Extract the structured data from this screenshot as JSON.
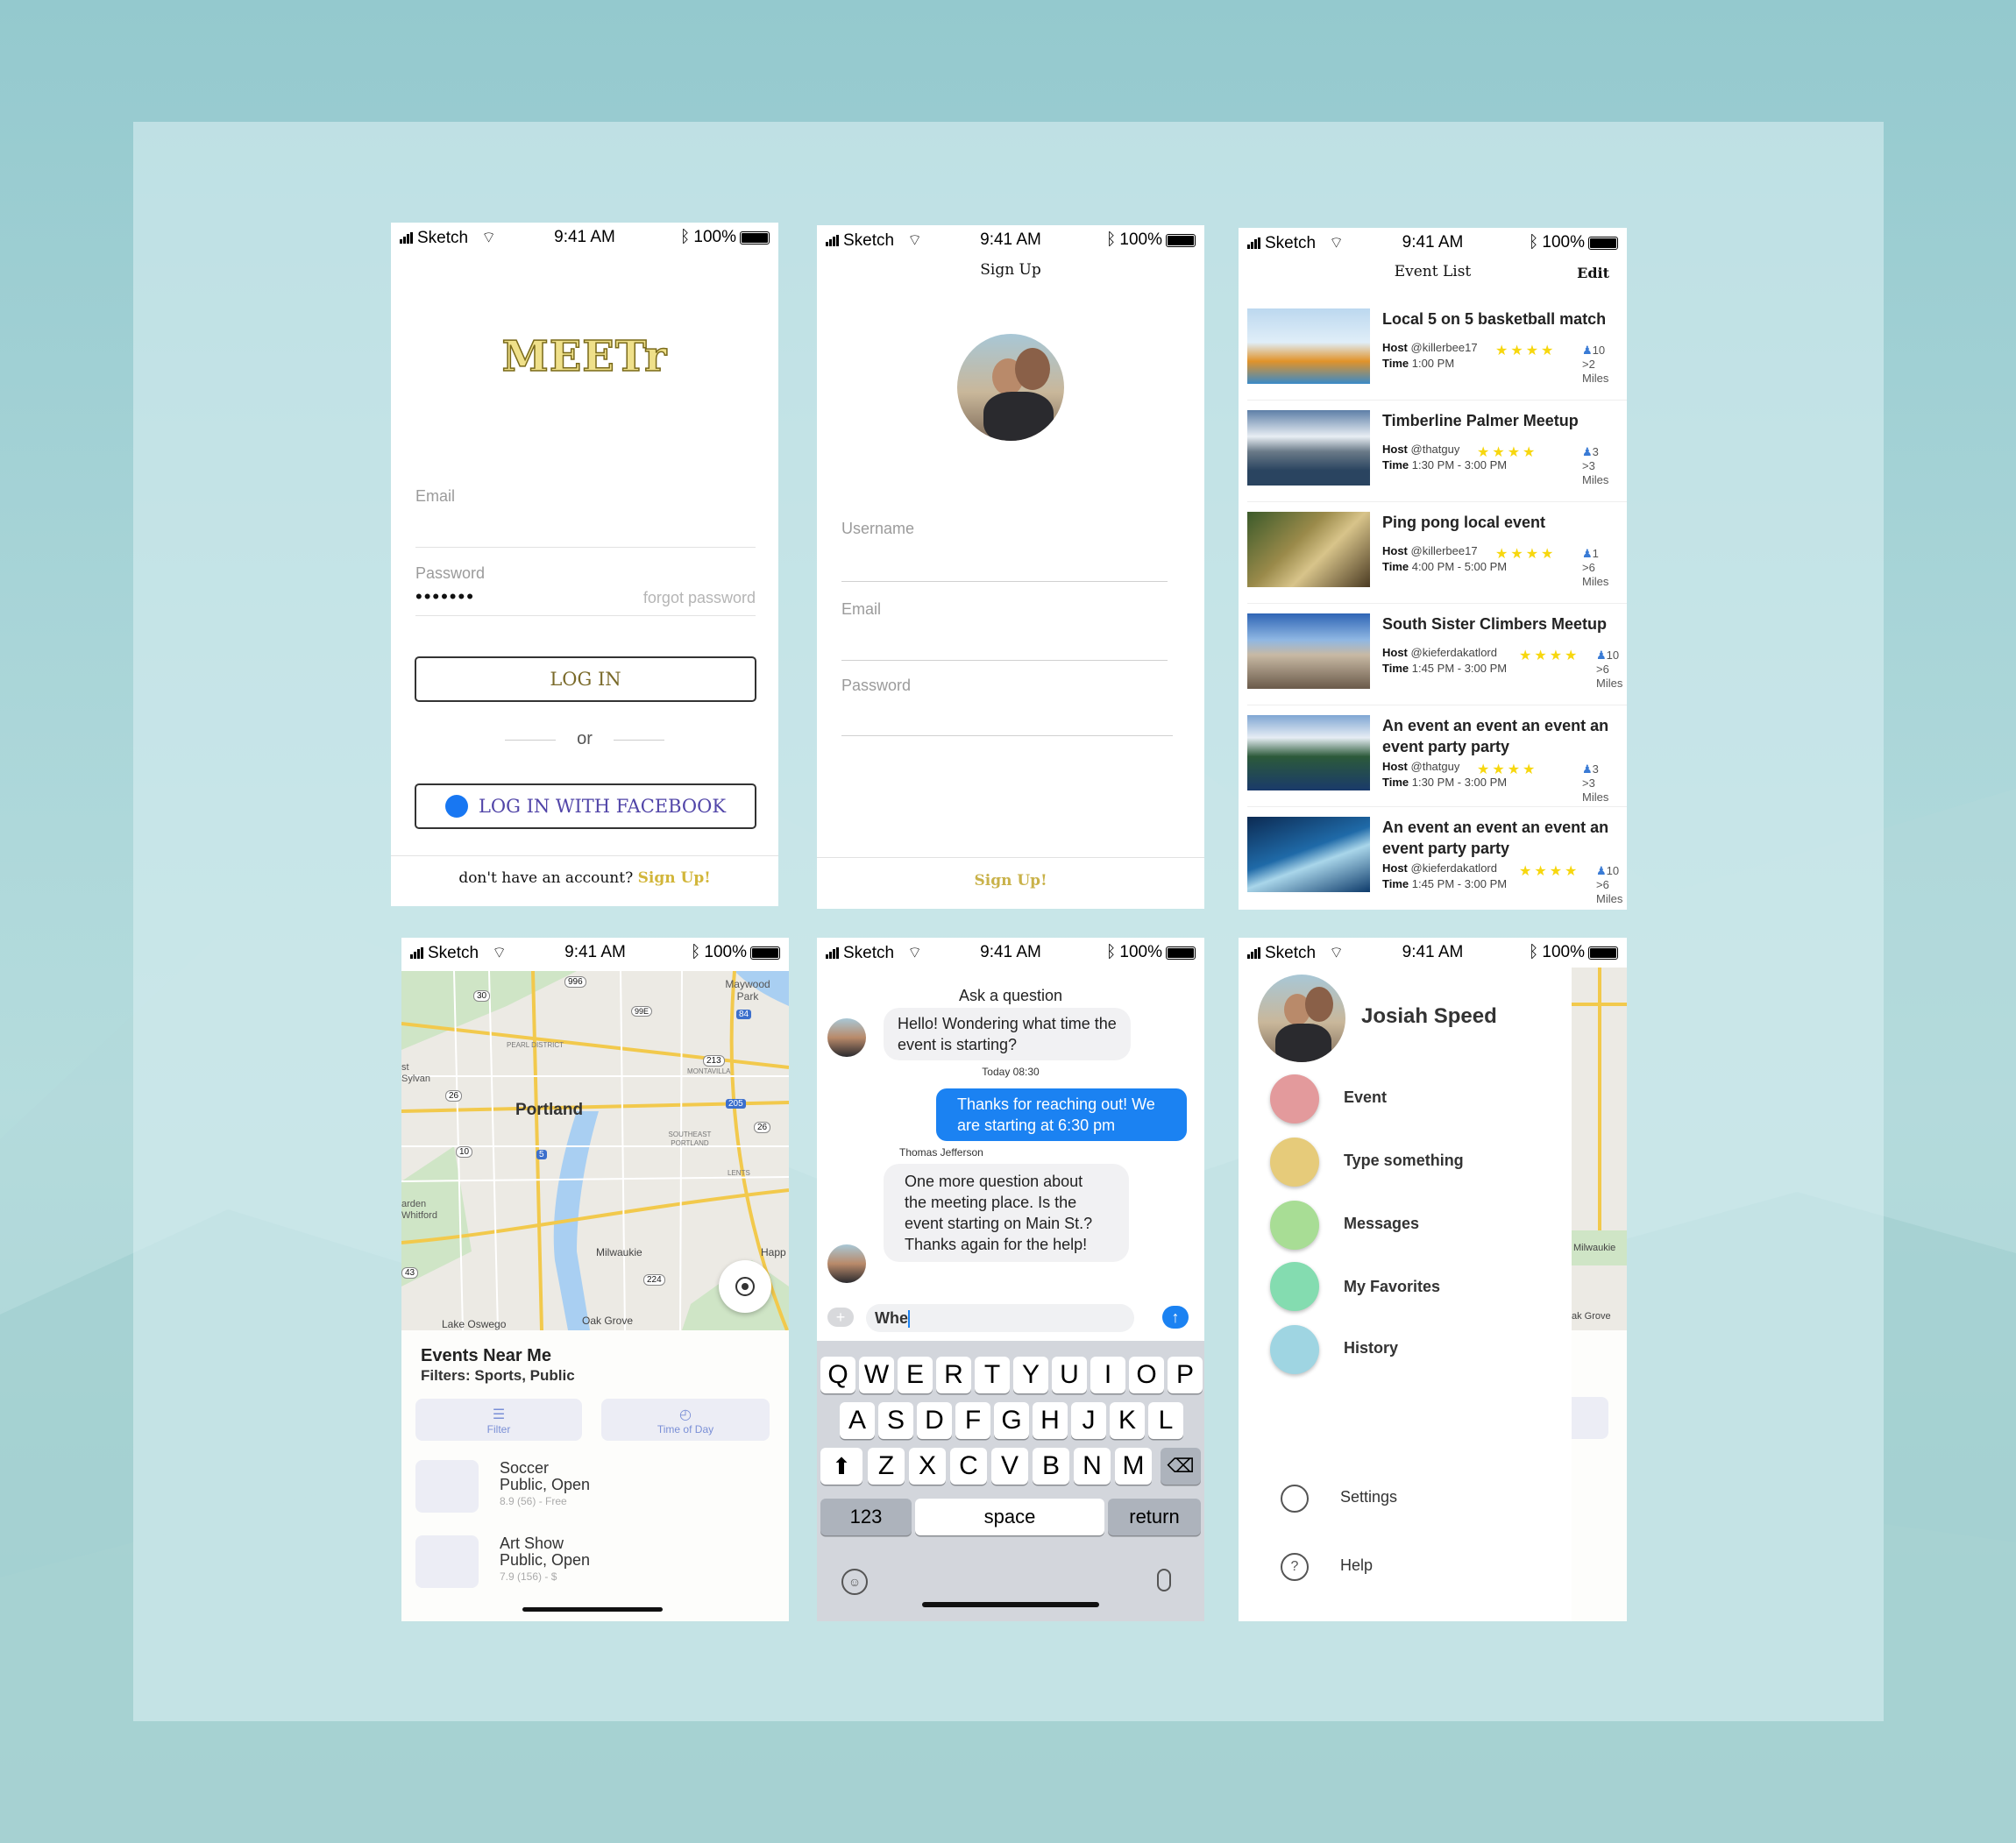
{
  "status": {
    "carrier": "Sketch",
    "time": "9:41 AM",
    "battery": "100%"
  },
  "login": {
    "logo": "MEETr",
    "email_label": "Email",
    "password_label": "Password",
    "password_value": "•••••••",
    "forgot": "forgot password",
    "login_btn": "LOG IN",
    "or": "or",
    "fb_btn": "LOG IN WITH FACEBOOK",
    "no_account": "don't have an account?",
    "signup_link": "Sign Up!"
  },
  "signup": {
    "title": "Sign Up",
    "username_label": "Username",
    "email_label": "Email",
    "password_label": "Password",
    "signup_btn": "Sign Up!"
  },
  "event_list": {
    "title": "Event List",
    "edit": "Edit",
    "host_label": "Host",
    "time_label": "Time",
    "events": [
      {
        "title": "Local 5 on 5 basketball match",
        "host": "@killerbee17",
        "time": "1:00 PM",
        "stars": "★★★★",
        "count": "10",
        "distance": ">2 Miles"
      },
      {
        "title": "Timberline Palmer Meetup",
        "host": "@thatguy",
        "time": "1:30 PM - 3:00 PM",
        "stars": "★★★★",
        "count": "3",
        "distance": ">3 Miles"
      },
      {
        "title": "Ping pong local event",
        "host": "@killerbee17",
        "time": "4:00 PM - 5:00 PM",
        "stars": "★★★★",
        "count": "1",
        "distance": ">6 Miles"
      },
      {
        "title": "South Sister Climbers Meetup",
        "host": "@kieferdakatlord",
        "time": "1:45 PM - 3:00 PM",
        "stars": "★★★★",
        "count": "10",
        "distance": ">6 Miles"
      },
      {
        "title": "An event an event an event an event party party",
        "host": "@thatguy",
        "time": "1:30 PM - 3:00 PM",
        "stars": "★★★★",
        "count": "3",
        "distance": ">3 Miles"
      },
      {
        "title": "An event an event an event an event party party",
        "host": "@kieferdakatlord",
        "time": "1:45 PM - 3:00 PM",
        "stars": "★★★★",
        "count": "10",
        "distance": ">6 Miles"
      }
    ]
  },
  "map": {
    "labels": {
      "portland": "Portland",
      "maywood": "Maywood Park",
      "milwaukie": "Milwaukie",
      "lake_oswego": "Lake Oswego",
      "oak_grove": "Oak Grove",
      "happy": "Happ",
      "sylvan": "st Sylvan",
      "whitford": "arden Whitford",
      "pearl": "PEARL DISTRICT",
      "montavilla": "MONTAVILLA",
      "southeast": "SOUTHEAST PORTLAND",
      "lents": "LENTS"
    },
    "shields": [
      "30",
      "996",
      "84",
      "213",
      "26",
      "205",
      "26",
      "5",
      "10",
      "224",
      "99E",
      "43"
    ],
    "heading": "Events Near Me",
    "filters": "Filters: Sports, Public",
    "filter_btn": "Filter",
    "time_btn": "Time of Day",
    "items": [
      {
        "name": "Soccer",
        "type": "Public, Open",
        "meta": "8.9 (56) - Free"
      },
      {
        "name": "Art Show",
        "type": "Public, Open",
        "meta": "7.9 (156) - $"
      }
    ]
  },
  "chat": {
    "header": "Ask a question",
    "msg1": "Hello! Wondering what time the event is starting?",
    "timestamp": "Today 08:30",
    "msg2": "Thanks for reaching out! We are starting at 6:30 pm",
    "sender": "Thomas Jefferson",
    "msg3": "One more question about the meeting place. Is the event starting on Main St.? Thanks again for the help!",
    "input_value": "Whe",
    "keys_row1": [
      "Q",
      "W",
      "E",
      "R",
      "T",
      "Y",
      "U",
      "I",
      "O",
      "P"
    ],
    "keys_row2": [
      "A",
      "S",
      "D",
      "F",
      "G",
      "H",
      "J",
      "K",
      "L"
    ],
    "keys_row3": [
      "Z",
      "X",
      "C",
      "V",
      "B",
      "N",
      "M"
    ],
    "key_123": "123",
    "key_space": "space",
    "key_return": "return"
  },
  "menu": {
    "user": "Josiah Speed",
    "items": [
      {
        "label": "Event",
        "color": "#e39a9c"
      },
      {
        "label": "Type something",
        "color": "#e6cb7a"
      },
      {
        "label": "Messages",
        "color": "#a8dd95"
      },
      {
        "label": "My Favorites",
        "color": "#84dcb0"
      },
      {
        "label": "History",
        "color": "#9fd5e2"
      }
    ],
    "settings": "Settings",
    "help": "Help",
    "help_glyph": "?",
    "bg_milwaukie": "Milwaukie",
    "bg_oakgrove": "ak Grove"
  }
}
